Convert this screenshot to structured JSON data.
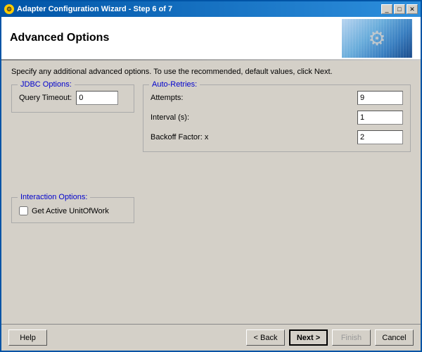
{
  "window": {
    "title": "Adapter Configuration Wizard - Step 6 of 7",
    "icon": "⚙"
  },
  "titlebar": {
    "minimize_label": "_",
    "maximize_label": "□",
    "close_label": "✕"
  },
  "header": {
    "title": "Advanced Options"
  },
  "description": "Specify any additional advanced options.  To use the recommended, default values, click Next.",
  "jdbc_options": {
    "legend": "JDBC Options:",
    "query_timeout_label": "Query Timeout:",
    "query_timeout_value": "0"
  },
  "auto_retries": {
    "legend": "Auto-Retries:",
    "attempts_label": "Attempts:",
    "attempts_value": "9",
    "interval_label": "Interval (s):",
    "interval_value": "1",
    "backoff_label": "Backoff Factor: x",
    "backoff_value": "2"
  },
  "interaction_options": {
    "legend": "Interaction Options:",
    "get_active_label": "Get Active UnitOfWork",
    "get_active_checked": false
  },
  "footer": {
    "help_label": "Help",
    "back_label": "< Back",
    "next_label": "Next >",
    "finish_label": "Finish",
    "cancel_label": "Cancel"
  }
}
